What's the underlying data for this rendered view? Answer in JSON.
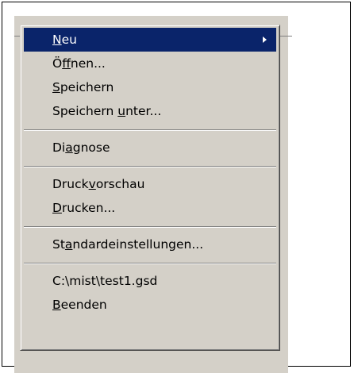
{
  "menu": {
    "items": [
      {
        "id": "neu",
        "pre": "",
        "mnemonic": "N",
        "post": "eu",
        "has_submenu": true,
        "selected": true
      },
      {
        "id": "oeffnen",
        "pre": "Ö",
        "mnemonic": "f",
        "post": "fnen...",
        "has_submenu": false,
        "selected": false
      },
      {
        "id": "speichern",
        "pre": "",
        "mnemonic": "S",
        "post": "peichern",
        "has_submenu": false,
        "selected": false
      },
      {
        "id": "speichern-unter",
        "pre": "Speichern ",
        "mnemonic": "u",
        "post": "nter...",
        "has_submenu": false,
        "selected": false
      },
      {
        "id": "diagnose",
        "pre": "Di",
        "mnemonic": "a",
        "post": "gnose",
        "has_submenu": false,
        "selected": false
      },
      {
        "id": "druckvorschau",
        "pre": "Druck",
        "mnemonic": "v",
        "post": "orschau",
        "has_submenu": false,
        "selected": false
      },
      {
        "id": "drucken",
        "pre": "",
        "mnemonic": "D",
        "post": "rucken...",
        "has_submenu": false,
        "selected": false
      },
      {
        "id": "standardeinstellungen",
        "pre": "St",
        "mnemonic": "a",
        "post": "ndardeinstellungen...",
        "has_submenu": false,
        "selected": false
      },
      {
        "id": "recent-file",
        "pre": "C:\\mist\\test1.gsd",
        "mnemonic": "",
        "post": "",
        "has_submenu": false,
        "selected": false
      },
      {
        "id": "beenden",
        "pre": "",
        "mnemonic": "B",
        "post": "eenden",
        "has_submenu": false,
        "selected": false
      }
    ]
  },
  "colors": {
    "menu_bg": "#d4d0c8",
    "highlight": "#0a246a",
    "highlight_text": "#ffffff"
  },
  "icons": {
    "submenu": "submenu-arrow-icon"
  }
}
